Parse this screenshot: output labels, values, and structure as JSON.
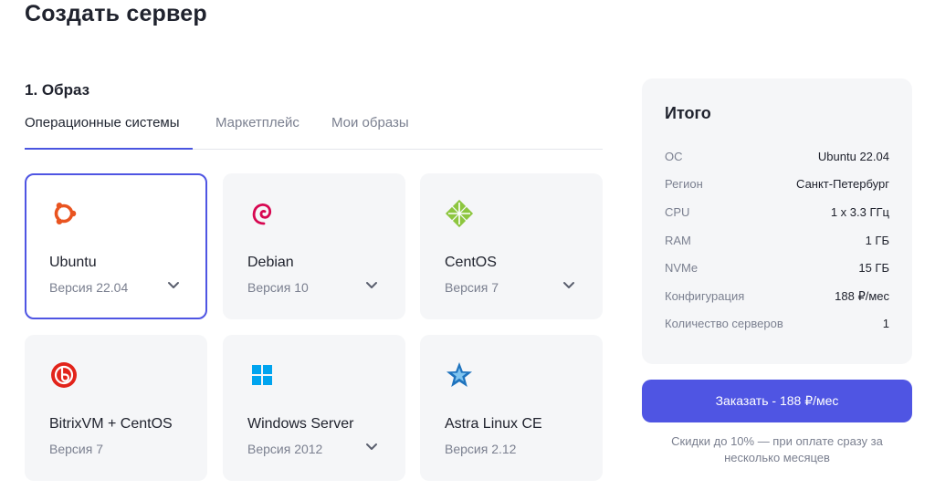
{
  "header": {
    "title": "Создать сервер"
  },
  "image_section": {
    "title": "1. Образ",
    "tabs": [
      {
        "label": "Операционные системы",
        "active": true
      },
      {
        "label": "Маркетплейс",
        "active": false
      },
      {
        "label": "Мои образы",
        "active": false
      }
    ]
  },
  "os_cards": [
    {
      "name": "Ubuntu",
      "version": "Версия 22.04",
      "icon": "ubuntu-icon",
      "selected": true,
      "has_dropdown": true
    },
    {
      "name": "Debian",
      "version": "Версия 10",
      "icon": "debian-icon",
      "selected": false,
      "has_dropdown": true
    },
    {
      "name": "CentOS",
      "version": "Версия 7",
      "icon": "centos-icon",
      "selected": false,
      "has_dropdown": true
    },
    {
      "name": "BitrixVM + CentOS",
      "version": "Версия 7",
      "icon": "bitrix-icon",
      "selected": false,
      "has_dropdown": false
    },
    {
      "name": "Windows Server",
      "version": "Версия 2012",
      "icon": "windows-icon",
      "selected": false,
      "has_dropdown": true
    },
    {
      "name": "Astra Linux CE",
      "version": "Версия 2.12",
      "icon": "astra-icon",
      "selected": false,
      "has_dropdown": false
    }
  ],
  "summary": {
    "title": "Итого",
    "rows": [
      {
        "label": "ОС",
        "value": "Ubuntu 22.04"
      },
      {
        "label": "Регион",
        "value": "Санкт-Петербург"
      },
      {
        "label": "CPU",
        "value": "1 x 3.3 ГГц"
      },
      {
        "label": "RAM",
        "value": "1 ГБ"
      },
      {
        "label": "NVMe",
        "value": "15 ГБ"
      },
      {
        "label": "Конфигурация",
        "value": "188 ₽/мес"
      },
      {
        "label": "Количество серверов",
        "value": "1"
      }
    ]
  },
  "order": {
    "button_label": "Заказать - 188 ₽/мес",
    "discount_note": "Скидки до 10% — при оплате сразу за несколько месяцев"
  },
  "colors": {
    "accent": "#4f55e3",
    "card_bg": "#f5f6f8",
    "ubuntu": "#e95420",
    "debian": "#d70751",
    "centos": "#8dc63f",
    "bitrix": "#e2231a",
    "windows": "#00a4ef",
    "astra": "#1e73be"
  }
}
